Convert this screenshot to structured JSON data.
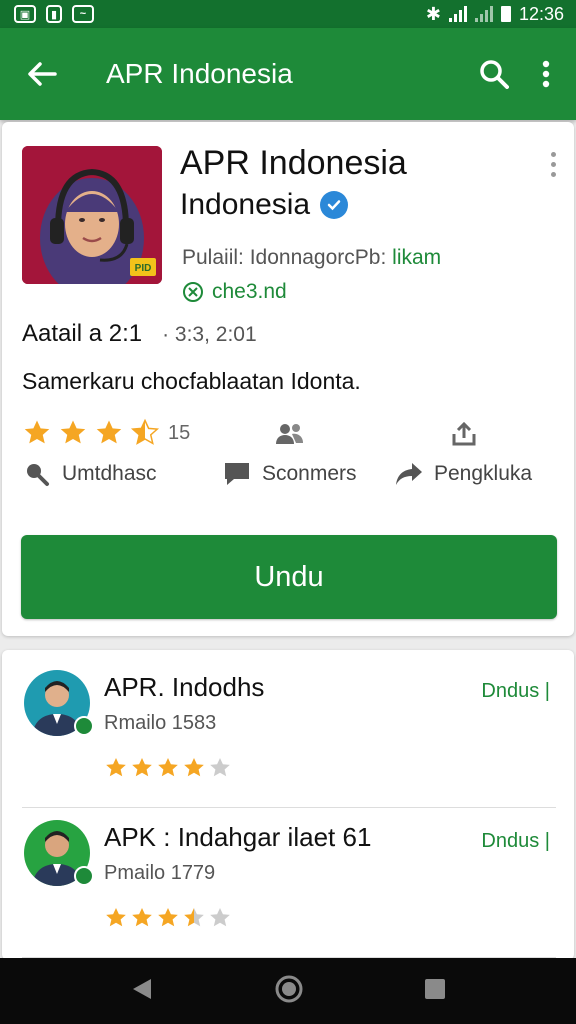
{
  "status_bar": {
    "time": "12:36",
    "left_icons": [
      "image-icon",
      "battery-saver-icon",
      "message-icon"
    ]
  },
  "app_bar": {
    "title": "APR Indonesia"
  },
  "app": {
    "name_line1": "APR Indonesia",
    "name_line2": "Indonesia",
    "publisher_prefix": "Pulaiil: ",
    "publisher_name": "IdonnagorcPb:",
    "publisher_link": " likam",
    "checked_text": "che3.nd",
    "meta_label": "Aatail a 2:1",
    "meta_date": "· 3:3, 2:01",
    "description": "Samerkaru chocfablaatan Idonta.",
    "rating": 3.5,
    "rating_count": "15",
    "actions": [
      {
        "icon": "speaker-icon",
        "label": "Umtdhasc"
      },
      {
        "icon": "comment-icon",
        "label": "Sconmers"
      },
      {
        "icon": "share-icon",
        "label": "Pengkluka"
      }
    ],
    "install_label": "Undu"
  },
  "related": [
    {
      "title": "APR. Indodhs",
      "subtitle": "Rmailo 1583",
      "rating": 4,
      "action": "Dndus |"
    },
    {
      "title": "APK : Indahgar ilaet 61",
      "subtitle": "Pmailo 1779",
      "rating": 3.5,
      "action": "Dndus |"
    }
  ],
  "colors": {
    "status_bar": "#13712e",
    "app_bar": "#1e8a39",
    "accent": "#1e8a39",
    "star": "#f5a623"
  }
}
